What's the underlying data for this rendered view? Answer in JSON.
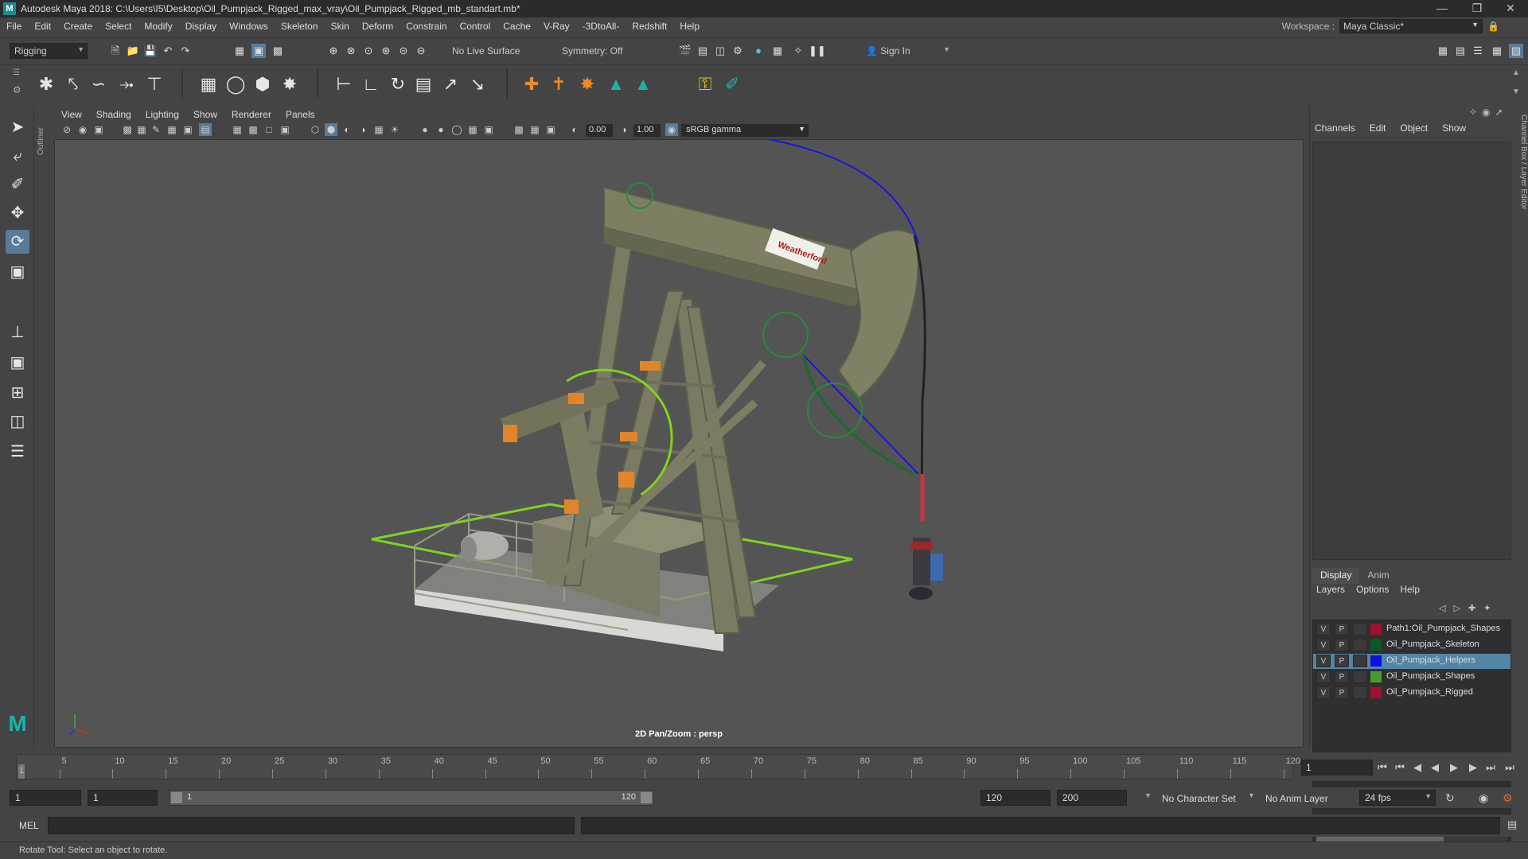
{
  "window": {
    "title": "Autodesk Maya 2018: C:\\Users\\I5\\Desktop\\Oil_Pumpjack_Rigged_max_vray\\Oil_Pumpjack_Rigged_mb_standart.mb*",
    "logo": "M"
  },
  "menu": [
    "File",
    "Edit",
    "Create",
    "Select",
    "Modify",
    "Display",
    "Windows",
    "Skeleton",
    "Skin",
    "Deform",
    "Constrain",
    "Control",
    "Cache",
    "V-Ray",
    "-3DtoAll-",
    "Redshift",
    "Help"
  ],
  "workspace": {
    "label": "Workspace :",
    "value": "Maya Classic*"
  },
  "statusline": {
    "mode": "Rigging",
    "live_surface": "No Live Surface",
    "symmetry": "Symmetry: Off",
    "sign_in": "Sign In"
  },
  "viewport": {
    "menu": [
      "View",
      "Shading",
      "Lighting",
      "Show",
      "Renderer",
      "Panels"
    ],
    "exposure": "0.00",
    "gamma": "1.00",
    "color_space": "sRGB gamma",
    "caption": "2D Pan/Zoom : persp",
    "outliner_tab": "Outliner",
    "logo_text": "Weatherford"
  },
  "channel_box": {
    "tabs": [
      "Channels",
      "Edit",
      "Object",
      "Show"
    ],
    "vertical_tab": "Channel Box / Layer Editor"
  },
  "layer_editor": {
    "tabs": [
      "Display",
      "Anim"
    ],
    "active_tab": "Display",
    "menu": [
      "Layers",
      "Options",
      "Help"
    ],
    "layers": [
      {
        "v": "V",
        "p": "P",
        "name": "Path1:Oil_Pumpjack_Shapes",
        "color": "#a01030",
        "selected": false
      },
      {
        "v": "V",
        "p": "P",
        "name": "Oil_Pumpjack_Skeleton",
        "color": "#0a5a28",
        "selected": false
      },
      {
        "v": "V",
        "p": "P",
        "name": "Oil_Pumpjack_Helpers",
        "color": "#1010e0",
        "selected": true
      },
      {
        "v": "V",
        "p": "P",
        "name": "Oil_Pumpjack_Shapes",
        "color": "#4a9a30",
        "selected": false
      },
      {
        "v": "V",
        "p": "P",
        "name": "Oil_Pumpjack_Rigged",
        "color": "#a01030",
        "selected": false
      }
    ]
  },
  "timeline": {
    "labels": [
      "5",
      "10",
      "15",
      "20",
      "25",
      "30",
      "35",
      "40",
      "45",
      "50",
      "55",
      "60",
      "65",
      "70",
      "75",
      "80",
      "85",
      "90",
      "95",
      "100",
      "105",
      "110",
      "115",
      "120"
    ],
    "start_marker": "1",
    "current_frame": "1"
  },
  "range": {
    "start": "1",
    "playback_start": "1",
    "slider_start": "1",
    "slider_end": "120",
    "playback_end": "120",
    "end": "200",
    "character_set": "No Character Set",
    "anim_layer": "No Anim Layer",
    "fps": "24 fps"
  },
  "command": {
    "label": "MEL"
  },
  "help_line": "Rotate Tool: Select an object to rotate."
}
